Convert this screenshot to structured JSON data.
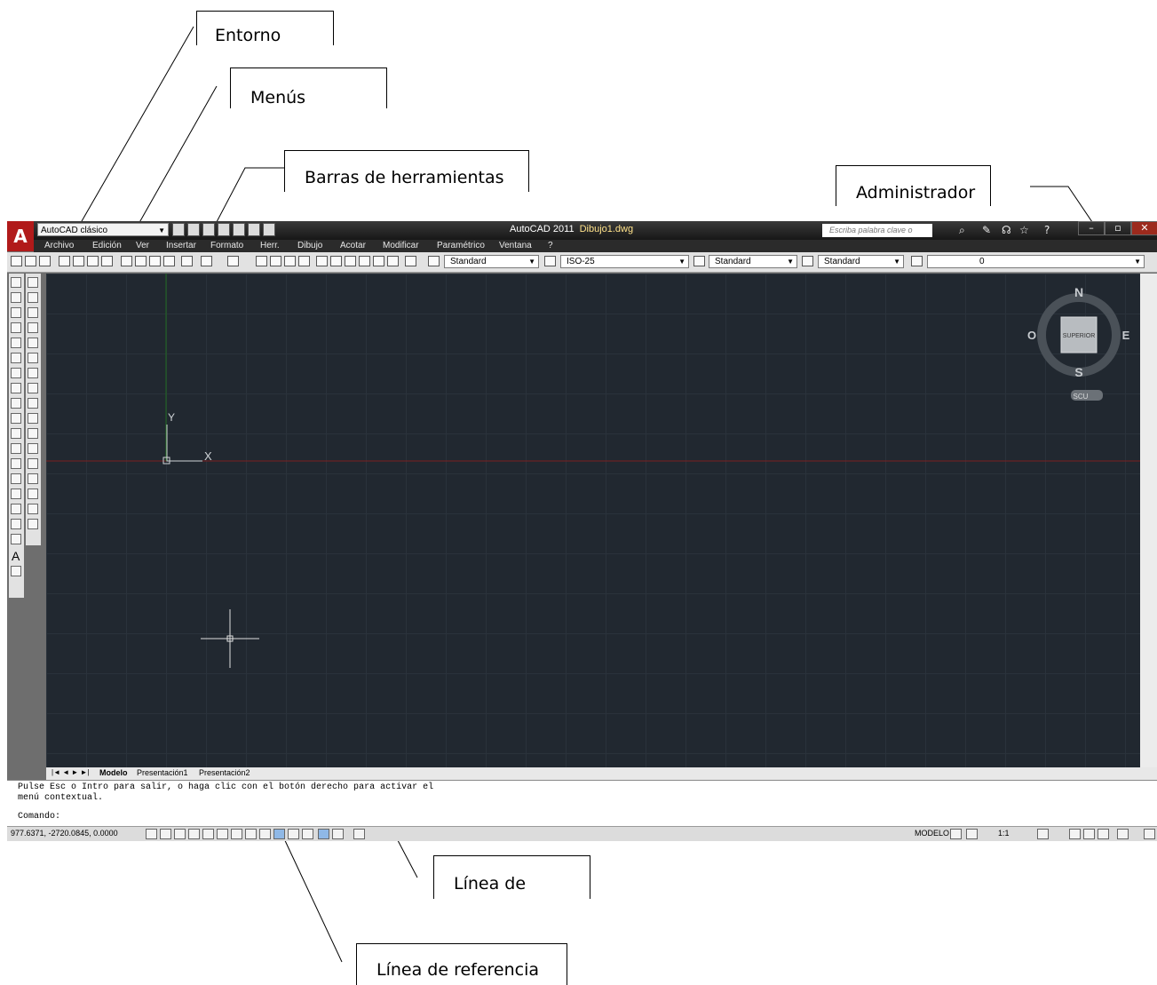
{
  "callouts": {
    "entorno": "Entorno",
    "menus": "Menús",
    "barras": "Barras de herramientas",
    "administrador": "Administrador",
    "linea_comando": "Línea de",
    "linea_referencia": "Línea de referencia"
  },
  "window": {
    "workspace": "AutoCAD clásico",
    "app_title": "AutoCAD 2011",
    "file_name": "Dibujo1.dwg",
    "search_placeholder": "Escriba palabra clave o frase",
    "help_icon": "?"
  },
  "menu": [
    "Archivo",
    "Edición",
    "Ver",
    "Insertar",
    "Formato",
    "Herr.",
    "Dibujo",
    "Acotar",
    "Modificar",
    "Paramétrico",
    "Ventana",
    "?"
  ],
  "toolbar": {
    "text_style": "Standard",
    "dim_style": "ISO-25",
    "table_style": "Standard",
    "mleader_style": "Standard",
    "layer": "0"
  },
  "left_toolbar": {
    "text_tool": "A"
  },
  "viewcube": {
    "north": "N",
    "south": "S",
    "east": "E",
    "west": "O",
    "face": "SUPERIOR",
    "ucs": "SCU"
  },
  "ucs_axes": {
    "x": "X",
    "y": "Y"
  },
  "tabs": [
    "Modelo",
    "Presentación1",
    "Presentación2"
  ],
  "command": {
    "line1": "Pulse Esc o Intro para salir, o haga clic con el botón derecho para activar el",
    "line2": "menú contextual.",
    "prompt": "Comando:"
  },
  "status": {
    "coords": "977.6371, -2720.0845, 0.0000",
    "mode": "MODELO",
    "scale": "1:1"
  },
  "colors": {
    "drawing_bg": "#212830",
    "grid": "#2a323b",
    "x_axis": "#7a2020",
    "y_axis": "#1f6a1f",
    "app_button": "#b11a1a"
  }
}
